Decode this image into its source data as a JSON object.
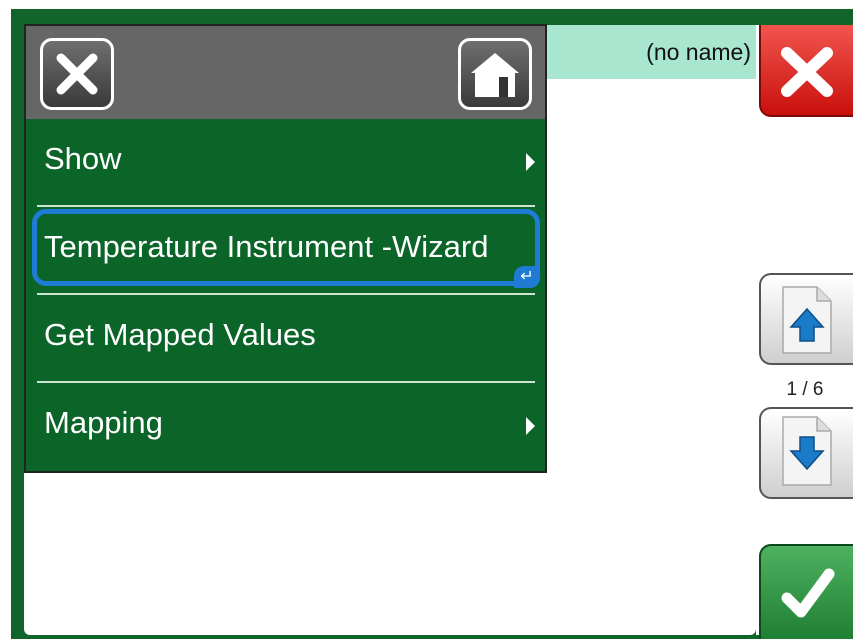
{
  "namebar": {
    "text": "(no name)"
  },
  "menu": {
    "items": [
      {
        "label": "Show",
        "has_submenu": true
      },
      {
        "label": "Temperature Instrument -Wizard",
        "has_submenu": false,
        "focused": true
      },
      {
        "label": "Get Mapped Values",
        "has_submenu": false
      },
      {
        "label": "Mapping",
        "has_submenu": true
      }
    ],
    "enter_glyph": "↵"
  },
  "pager": {
    "indicator": "1 / 6"
  },
  "colors": {
    "frame": "#12652a",
    "menu_bg": "#0b6428",
    "header_bg": "#666666",
    "focus": "#1f7bd3",
    "cancel": "#d91b16",
    "accept": "#2e9443",
    "namebar": "#a8e6d0"
  },
  "icons": {
    "menu_close": "close-icon",
    "menu_home": "home-icon",
    "cancel": "close-icon",
    "accept": "check-icon",
    "page_up": "page-up-icon",
    "page_down": "page-down-icon"
  }
}
